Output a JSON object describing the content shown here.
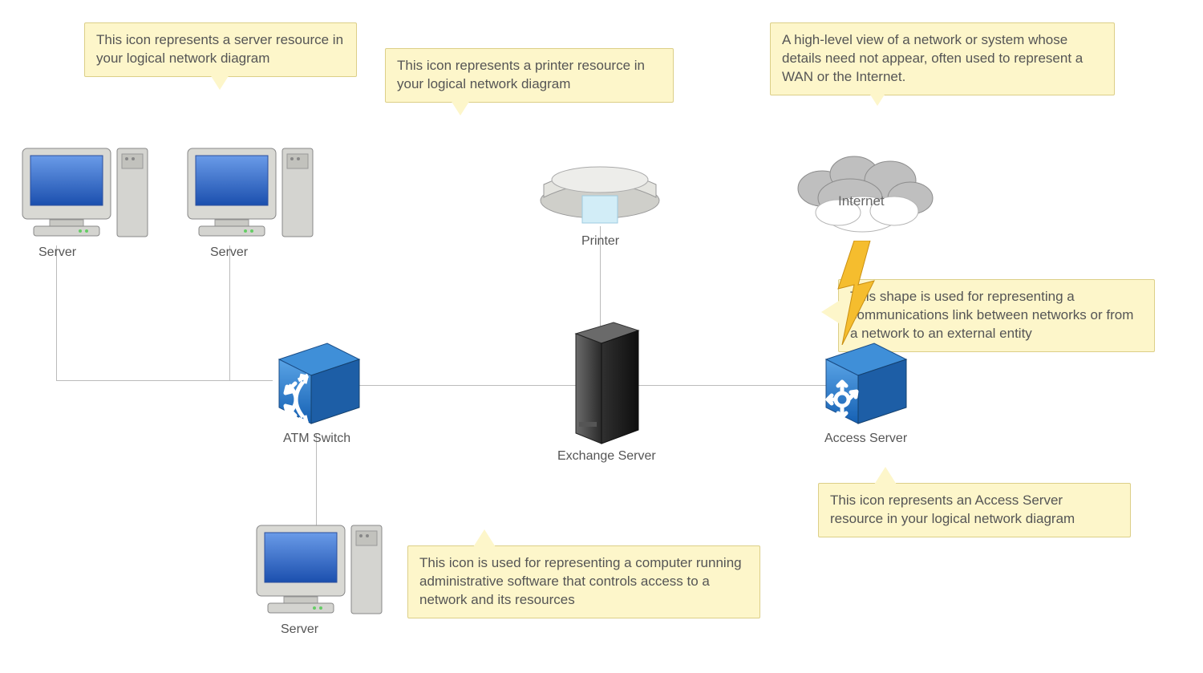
{
  "callouts": {
    "server": "This icon represents a server resource in your logical network diagram",
    "printer": "This icon represents a printer resource in your logical network diagram",
    "cloud": "A high-level view of a network or system whose details need not appear, often used to represent a WAN or the Internet.",
    "commlink": "This shape is used for representing a communications link between networks or from a network to an external entity",
    "access": "This icon represents an Access Server resource in your logical network diagram",
    "exchange": "This icon is used for representing a computer running administrative software that controls access to a network and its resources"
  },
  "labels": {
    "server1": "Server",
    "server2": "Server",
    "server3": "Server",
    "printer": "Printer",
    "atmswitch": "ATM Switch",
    "exchange": "Exchange Server",
    "access": "Access Server",
    "internet": "Internet"
  },
  "diagram": {
    "nodes": [
      {
        "id": "server1",
        "type": "server",
        "label_key": "server1"
      },
      {
        "id": "server2",
        "type": "server",
        "label_key": "server2"
      },
      {
        "id": "server3",
        "type": "server",
        "label_key": "server3"
      },
      {
        "id": "printer",
        "type": "printer",
        "label_key": "printer"
      },
      {
        "id": "atm",
        "type": "atm-switch",
        "label_key": "atmswitch"
      },
      {
        "id": "exchange",
        "type": "exchange-server",
        "label_key": "exchange"
      },
      {
        "id": "access",
        "type": "access-server",
        "label_key": "access"
      },
      {
        "id": "internet",
        "type": "cloud",
        "label_key": "internet"
      }
    ],
    "connections": [
      [
        "server1",
        "atm"
      ],
      [
        "server2",
        "atm"
      ],
      [
        "server3",
        "atm"
      ],
      [
        "atm",
        "exchange"
      ],
      [
        "exchange",
        "printer"
      ],
      [
        "exchange",
        "access"
      ],
      [
        "access",
        "internet"
      ]
    ]
  }
}
